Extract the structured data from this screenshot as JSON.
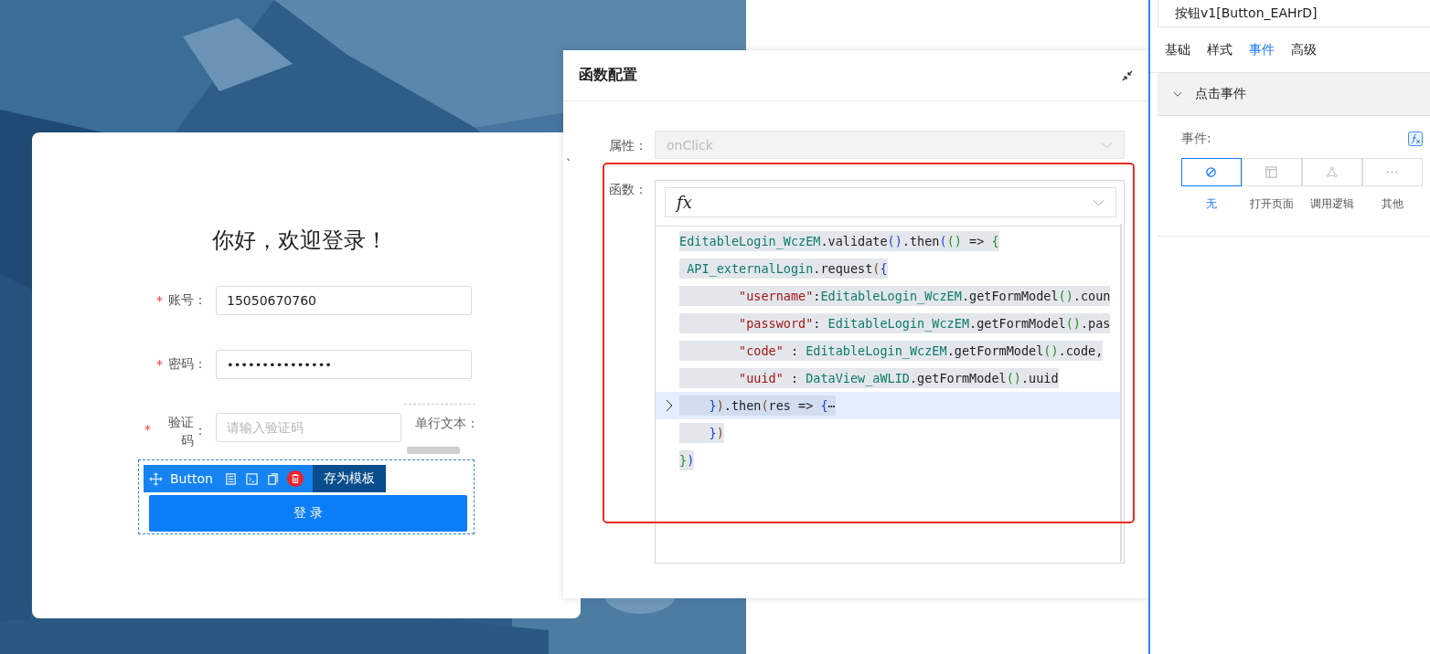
{
  "login_card": {
    "title": "你好，欢迎登录！",
    "required_mark": "*",
    "fields": [
      {
        "label": "账号：",
        "required": true,
        "value": "15050670760"
      },
      {
        "label": "密码：",
        "required": true,
        "value": "•••••••••••••••"
      },
      {
        "label": "验证码",
        "required": true,
        "placeholder": "请输入验证码"
      }
    ],
    "field_colon": "：",
    "side_field": {
      "label": "单行文本："
    },
    "toolbar": {
      "label": "Button",
      "save_template": "存为模板"
    },
    "submit": "登 录"
  },
  "dialog": {
    "title": "函数配置",
    "stray_mark": "`",
    "property": {
      "label": "属性：",
      "value": "onClick",
      "disabled": true
    },
    "function": {
      "label": "函数：",
      "fx": "fx",
      "code": [
        {
          "folded": false,
          "tokens": [
            {
              "text": "EditableLogin_WczEM",
              "kind": "ident"
            },
            {
              "text": ".validate",
              "kind": "plain"
            },
            {
              "text": "()",
              "kind": "p1"
            },
            {
              "text": ".then",
              "kind": "plain"
            },
            {
              "text": "(",
              "kind": "p1"
            },
            {
              "text": "()",
              "kind": "p2"
            },
            {
              "text": " => ",
              "kind": "plain"
            },
            {
              "text": "{",
              "kind": "p2"
            }
          ]
        },
        {
          "folded": false,
          "tokens": [
            {
              "text": " API_externalLogin",
              "kind": "ident"
            },
            {
              "text": ".request",
              "kind": "plain"
            },
            {
              "text": "(",
              "kind": "p3"
            },
            {
              "text": "{",
              "kind": "p1"
            }
          ]
        },
        {
          "folded": false,
          "tokens": [
            {
              "text": "        \"username\"",
              "kind": "string"
            },
            {
              "text": ":",
              "kind": "plain"
            },
            {
              "text": "EditableLogin_WczEM",
              "kind": "ident"
            },
            {
              "text": ".getFormModel",
              "kind": "plain"
            },
            {
              "text": "()",
              "kind": "p2"
            },
            {
              "text": ".coun",
              "kind": "plain"
            }
          ]
        },
        {
          "folded": false,
          "tokens": [
            {
              "text": "        \"password\"",
              "kind": "string"
            },
            {
              "text": ": ",
              "kind": "plain"
            },
            {
              "text": "EditableLogin_WczEM",
              "kind": "ident"
            },
            {
              "text": ".getFormModel",
              "kind": "plain"
            },
            {
              "text": "()",
              "kind": "p2"
            },
            {
              "text": ".pas",
              "kind": "plain"
            }
          ]
        },
        {
          "folded": false,
          "tokens": [
            {
              "text": "        \"code\"",
              "kind": "string"
            },
            {
              "text": " : ",
              "kind": "plain"
            },
            {
              "text": "EditableLogin_WczEM",
              "kind": "ident"
            },
            {
              "text": ".getFormModel",
              "kind": "plain"
            },
            {
              "text": "()",
              "kind": "p2"
            },
            {
              "text": ".code,",
              "kind": "plain"
            }
          ]
        },
        {
          "folded": false,
          "tokens": [
            {
              "text": "        \"uuid\"",
              "kind": "string"
            },
            {
              "text": " : ",
              "kind": "plain"
            },
            {
              "text": "DataView_aWLID",
              "kind": "ident"
            },
            {
              "text": ".getFormModel",
              "kind": "plain"
            },
            {
              "text": "()",
              "kind": "p2"
            },
            {
              "text": ".uuid",
              "kind": "plain"
            }
          ]
        },
        {
          "folded": true,
          "tokens": [
            {
              "text": "    }",
              "kind": "p1"
            },
            {
              "text": ")",
              "kind": "p3"
            },
            {
              "text": ".then",
              "kind": "plain"
            },
            {
              "text": "(",
              "kind": "p3"
            },
            {
              "text": "res => ",
              "kind": "plain"
            },
            {
              "text": "{",
              "kind": "p1"
            },
            {
              "text": "⋯",
              "kind": "plain"
            }
          ]
        },
        {
          "folded": false,
          "tokens": [
            {
              "text": "    }",
              "kind": "p1"
            },
            {
              "text": ")",
              "kind": "p3"
            }
          ]
        },
        {
          "folded": false,
          "tokens": [
            {
              "text": "}",
              "kind": "p2"
            },
            {
              "text": ")",
              "kind": "p1"
            }
          ]
        }
      ]
    }
  },
  "panel": {
    "title": "按钮v1[Button_EAHrD]",
    "tabs": [
      {
        "label": "基础",
        "selected": false
      },
      {
        "label": "样式",
        "selected": false
      },
      {
        "label": "事件",
        "selected": true
      },
      {
        "label": "高级",
        "selected": false
      }
    ],
    "section": {
      "title": "点击事件",
      "expanded": true
    },
    "event_label": "事件:",
    "options": [
      {
        "label": "无",
        "kind": "none",
        "selected": true
      },
      {
        "label": "打开页面",
        "kind": "page",
        "selected": false
      },
      {
        "label": "调用逻辑",
        "kind": "logic",
        "selected": false
      },
      {
        "label": "其他",
        "kind": "more",
        "selected": false
      }
    ]
  }
}
